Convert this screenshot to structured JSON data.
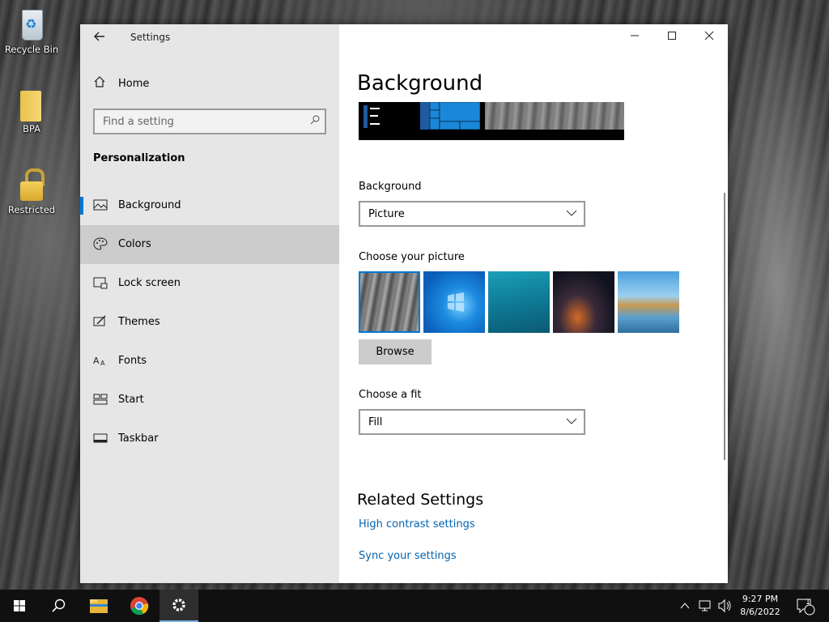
{
  "desktop": {
    "icons": [
      {
        "label": "Recycle Bin",
        "icon": "recycle-bin-icon"
      },
      {
        "label": "BPA",
        "icon": "folder-icon"
      },
      {
        "label": "Restricted",
        "icon": "lock-icon"
      }
    ]
  },
  "window": {
    "title": "Settings",
    "controls": {
      "minimize": "—",
      "maximize": "☐",
      "close": "✕"
    }
  },
  "sidebar": {
    "home_label": "Home",
    "search_placeholder": "Find a setting",
    "section_heading": "Personalization",
    "items": [
      {
        "label": "Background",
        "icon": "picture-icon",
        "active": true
      },
      {
        "label": "Colors",
        "icon": "palette-icon",
        "hover": true
      },
      {
        "label": "Lock screen",
        "icon": "lock-screen-icon"
      },
      {
        "label": "Themes",
        "icon": "brush-icon"
      },
      {
        "label": "Fonts",
        "icon": "font-icon"
      },
      {
        "label": "Start",
        "icon": "start-icon"
      },
      {
        "label": "Taskbar",
        "icon": "taskbar-icon"
      }
    ]
  },
  "main": {
    "page_title": "Background",
    "background_label": "Background",
    "background_value": "Picture",
    "choose_picture_label": "Choose your picture",
    "browse_label": "Browse",
    "fit_label": "Choose a fit",
    "fit_value": "Fill",
    "related_title": "Related Settings",
    "links": [
      "High contrast settings",
      "Sync your settings"
    ]
  },
  "taskbar": {
    "buttons": [
      "start-icon",
      "search-icon",
      "file-explorer-icon",
      "chrome-icon",
      "settings-icon"
    ],
    "time": "9:27 PM",
    "date": "8/6/2022",
    "notification_count": "1"
  },
  "colors": {
    "accent": "#0078d7",
    "link": "#0063b1",
    "sidebar_bg": "#e6e6e6"
  }
}
